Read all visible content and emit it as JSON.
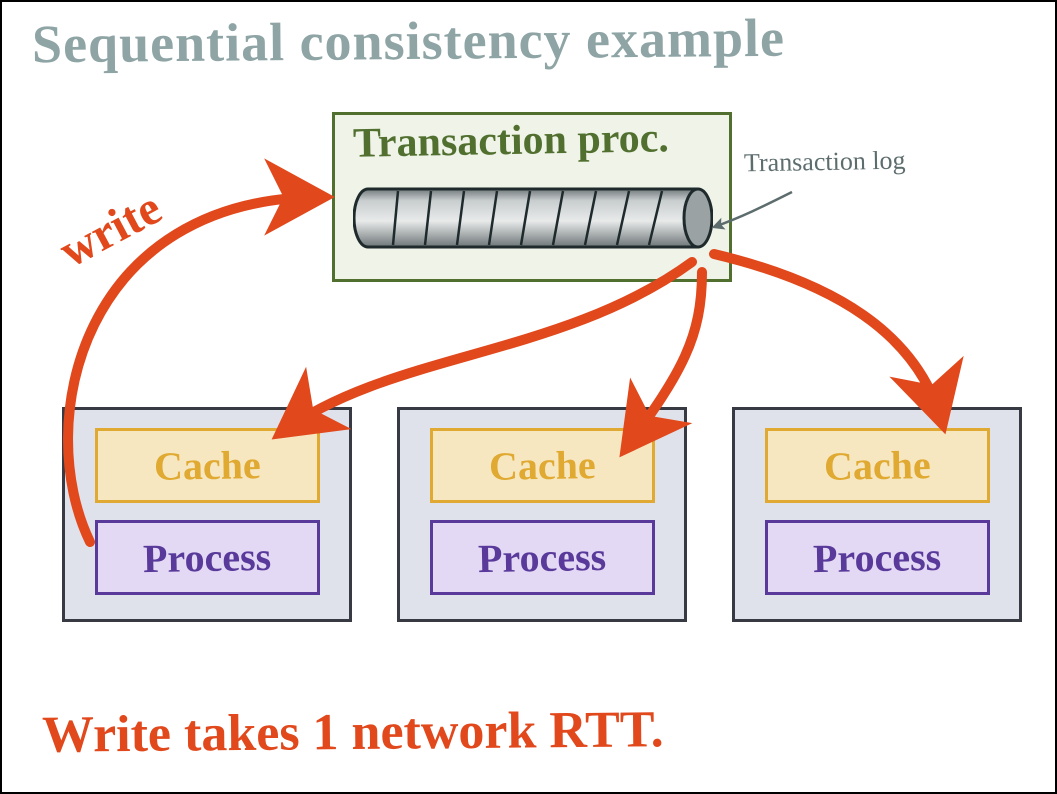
{
  "title": "Sequential consistency example",
  "transaction_processor": {
    "label": "Transaction proc.",
    "log_label": "Transaction log"
  },
  "write_label": "write",
  "nodes": [
    {
      "cache_label": "Cache",
      "process_label": "Process"
    },
    {
      "cache_label": "Cache",
      "process_label": "Process"
    },
    {
      "cache_label": "Cache",
      "process_label": "Process"
    }
  ],
  "caption": "Write takes 1 network RTT."
}
